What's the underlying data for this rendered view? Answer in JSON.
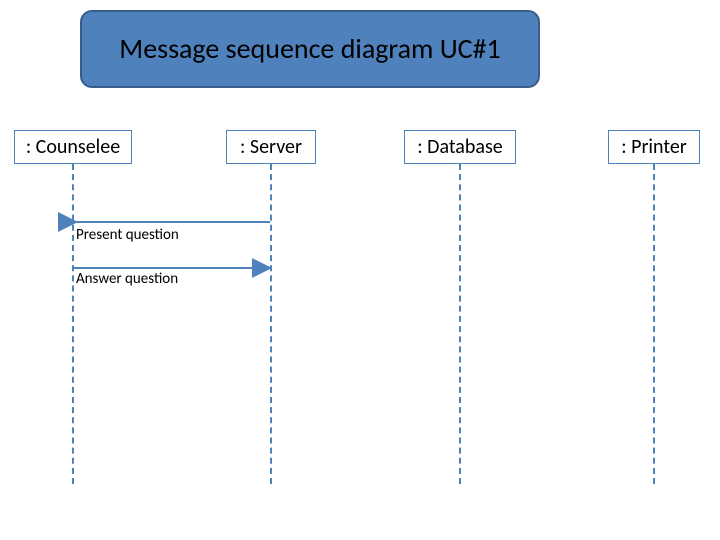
{
  "title": "Message sequence diagram UC#1",
  "participants": {
    "counselee": ": Counselee",
    "server": ": Server",
    "database": ": Database",
    "printer": ": Printer"
  },
  "messages": {
    "present_question": "Present question",
    "answer_question": "Answer question"
  },
  "colors": {
    "box_fill": "#4f81bd",
    "box_border": "#385d8a",
    "line": "#4f81bd"
  },
  "chart_data": {
    "type": "sequence-diagram",
    "title": "Message sequence diagram UC#1",
    "participants": [
      ": Counselee",
      ": Server",
      ": Database",
      ": Printer"
    ],
    "messages": [
      {
        "from": ": Server",
        "to": ": Counselee",
        "label": "Present question"
      },
      {
        "from": ": Counselee",
        "to": ": Server",
        "label": "Answer question"
      }
    ]
  }
}
